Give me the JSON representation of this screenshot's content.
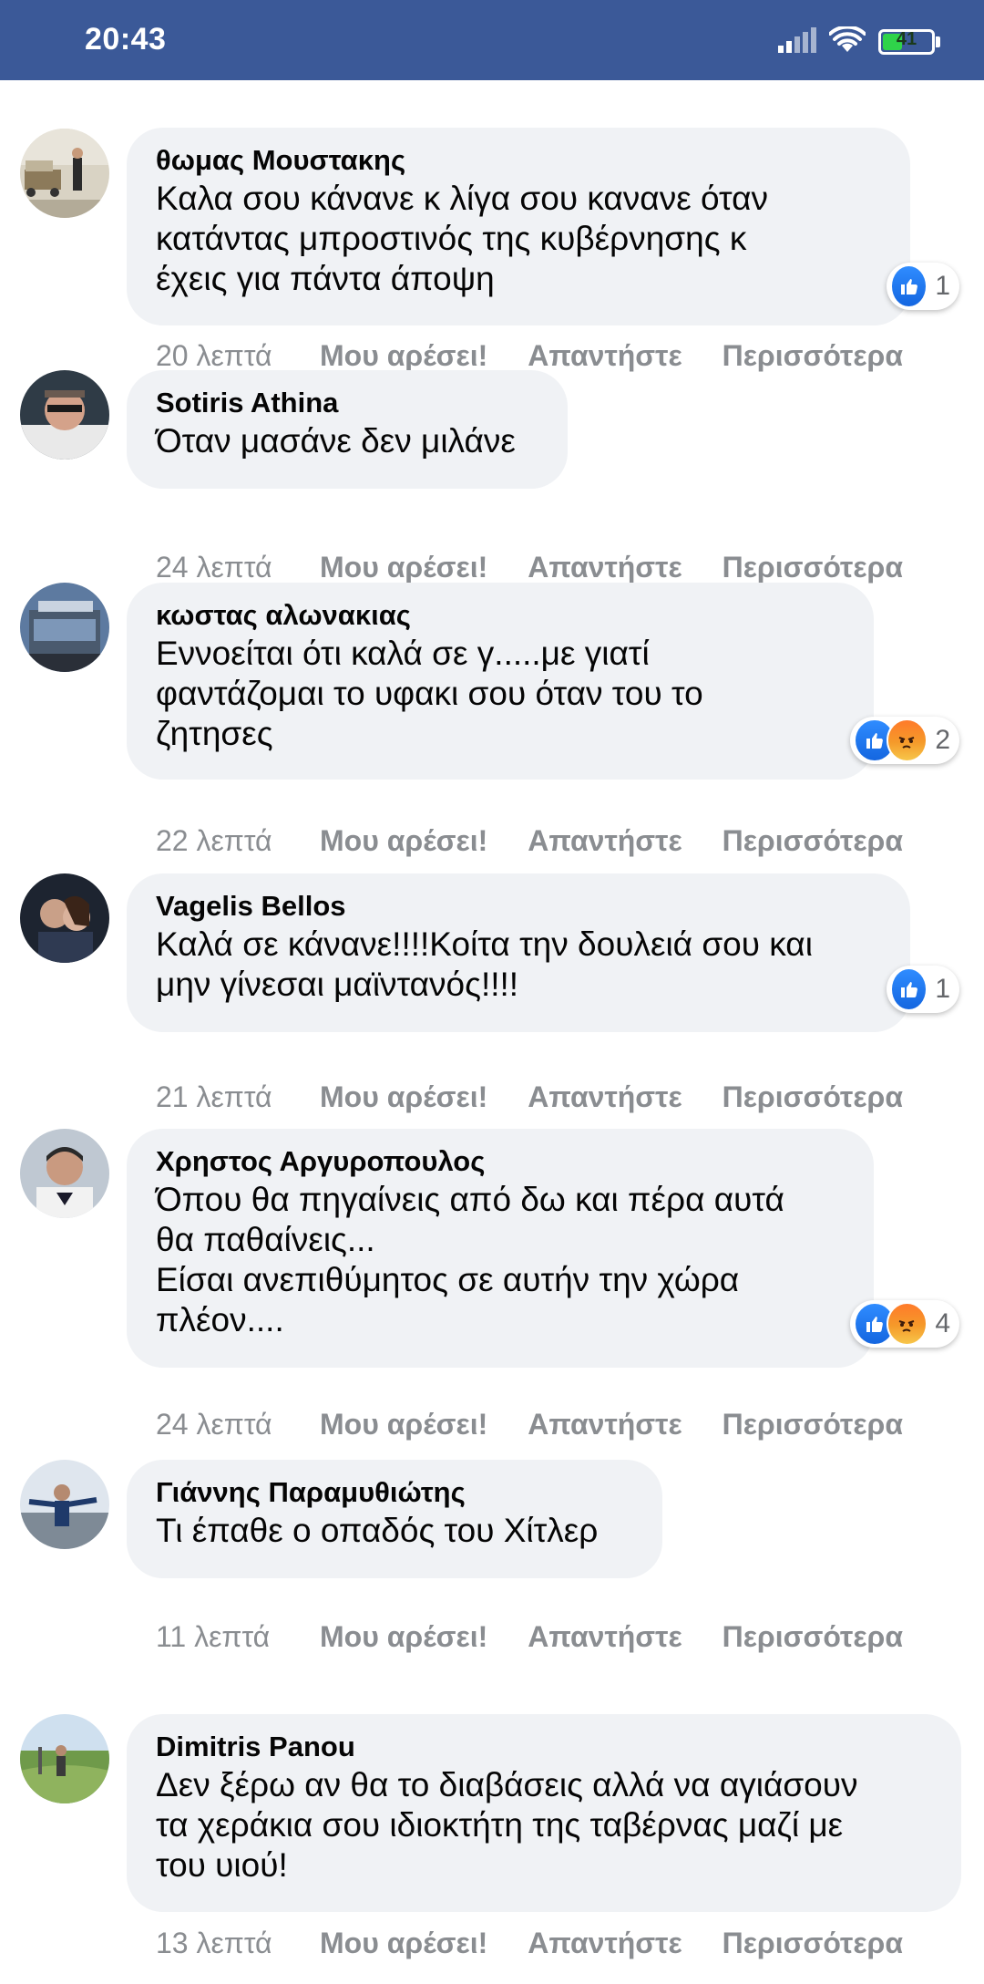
{
  "status_bar": {
    "time": "20:43",
    "battery_level": "41",
    "icons": [
      "signal-icon",
      "wifi-icon",
      "battery-icon"
    ],
    "color": "#3b5998"
  },
  "comments": [
    {
      "author": "θωμας Μουστακης",
      "text": "Καλα σου κάνανε κ λίγα σου κανανε όταν\nκατάντας μπροστινός της κυβέρνησης κ\nέχεις για πάντα άποψη",
      "time": "20 λεπτά",
      "like": "Μου αρέσει!",
      "reply": "Απαντήστε",
      "more": "Περισσότερα",
      "reactions": [
        "like"
      ],
      "reaction_count": "1"
    },
    {
      "author": "Sotiris Athina",
      "text": "Όταν μασάνε δεν μιλάνε",
      "time": "24 λεπτά",
      "like": "Μου αρέσει!",
      "reply": "Απαντήστε",
      "more": "Περισσότερα",
      "reactions": [],
      "reaction_count": ""
    },
    {
      "author": "κωστας αλωνακιας",
      "text": "Εννοείται ότι καλά σε γ.....με γιατί\nφαντάζομαι το υφακι σου όταν του το\nζητησες",
      "time": "22 λεπτά",
      "like": "Μου αρέσει!",
      "reply": "Απαντήστε",
      "more": "Περισσότερα",
      "reactions": [
        "like",
        "angry"
      ],
      "reaction_count": "2"
    },
    {
      "author": "Vagelis Bellos",
      "text": "Καλά σε κάνανε!!!!Κοίτα την δουλειά σου και\nμην γίνεσαι μαϊντανός!!!!",
      "time": "21 λεπτά",
      "like": "Μου αρέσει!",
      "reply": "Απαντήστε",
      "more": "Περισσότερα",
      "reactions": [
        "like"
      ],
      "reaction_count": "1"
    },
    {
      "author": "Χρηστος Αργυροπουλος",
      "text": "Όπου θα πηγαίνεις από δω και πέρα αυτά\nθα παθαίνεις...\nΕίσαι ανεπιθύμητος σε αυτήν την χώρα\nπλέον....",
      "time": "24 λεπτά",
      "like": "Μου αρέσει!",
      "reply": "Απαντήστε",
      "more": "Περισσότερα",
      "reactions": [
        "like",
        "angry"
      ],
      "reaction_count": "4"
    },
    {
      "author": "Γιάννης Παραμυθιώτης",
      "text": "Τι έπαθε ο οπαδός του Χίτλερ",
      "time": "11 λεπτά",
      "like": "Μου αρέσει!",
      "reply": "Απαντήστε",
      "more": "Περισσότερα",
      "reactions": [],
      "reaction_count": ""
    },
    {
      "author": "Dimitris Panou",
      "text": "Δεν ξέρω αν θα το διαβάσεις αλλά να αγιάσουν\nτα χεράκια σου ιδιοκτήτη της ταβέρνας μαζί με\nτου υιού!",
      "time": "13 λεπτά",
      "like": "Μου αρέσει!",
      "reply": "Απαντήστε",
      "more": "Περισσότερα",
      "reactions": [],
      "reaction_count": ""
    }
  ]
}
